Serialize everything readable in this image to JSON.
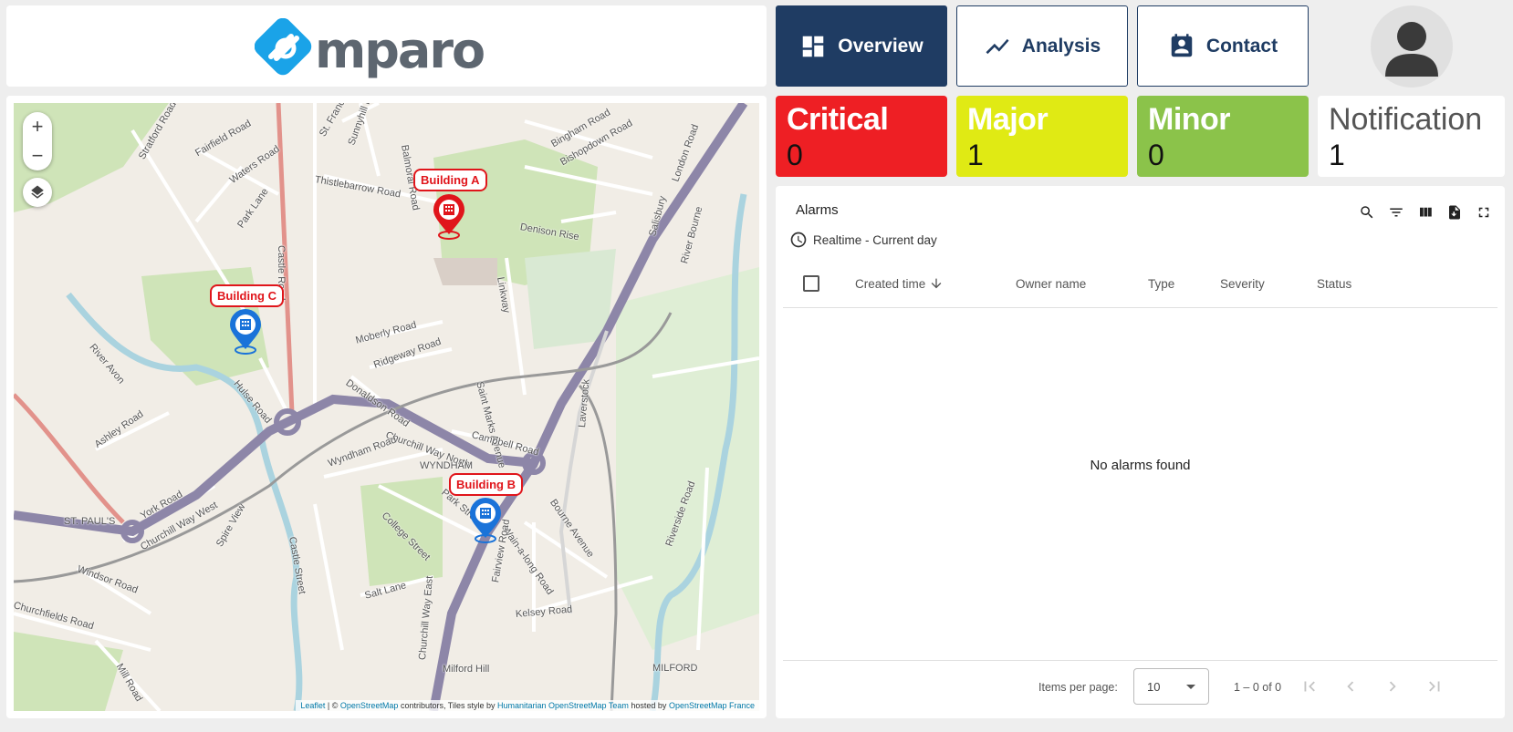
{
  "logo": {
    "text": "mparo",
    "brand_color": "#1aa3e8",
    "text_color": "#5d6670"
  },
  "nav": {
    "overview": "Overview",
    "analysis": "Analysis",
    "contact": "Contact",
    "active": "overview",
    "color": "#1f3c63"
  },
  "severity": {
    "critical": {
      "label": "Critical",
      "count": "0",
      "color": "#ee1f24"
    },
    "major": {
      "label": "Major",
      "count": "1",
      "color": "#e0ea14"
    },
    "minor": {
      "label": "Minor",
      "count": "0",
      "color": "#8bc34a"
    },
    "notification": {
      "label": "Notification",
      "count": "1",
      "color": "#ffffff"
    }
  },
  "map": {
    "zoom_in": "+",
    "zoom_out": "−",
    "markers": [
      {
        "label": "Building A",
        "color": "#e0151b"
      },
      {
        "label": "Building B",
        "color": "#1a73d9"
      },
      {
        "label": "Building C",
        "color": "#1a73d9"
      }
    ],
    "attribution": {
      "leaflet": "Leaflet",
      "sep": " | © ",
      "osm": "OpenStreetMap",
      "contrib": " contributors, Tiles style by ",
      "hot": "Humanitarian OpenStreetMap Team",
      "hosted": " hosted by ",
      "osmfr": "OpenStreetMap France"
    },
    "street_labels": [
      "Stratford Road",
      "Fairfield Road",
      "Waters Road",
      "Park Lane",
      "Castle Road",
      "St. Francis",
      "Sunnyhill Road",
      "Balmoral Road",
      "Thistlebarrow Road",
      "Bingham Road",
      "Bishopdown Road",
      "Denison Rise",
      "London Road",
      "Salisbury",
      "River Bourne",
      "Linkway",
      "Moberly Road",
      "Ridgeway Road",
      "Donaldson Road",
      "Hulse Road",
      "River Avon",
      "Saint Marks Avenue",
      "Ashley Road",
      "Churchill Way North",
      "Campbell Road",
      "Wyndham Road",
      "WYNDHAM",
      "Castle Street",
      "College Street",
      "Park Street",
      "Wain-a-long Road",
      "Bourne Avenue",
      "Laverstock",
      "Fairview Road",
      "Riverside Road",
      "York Road",
      "ST. PAUL'S",
      "Churchill Way West",
      "Spire View",
      "Windsor Road",
      "Salt Lane",
      "Kelsey Road",
      "Churchill Way East",
      "Churchfields Road",
      "Mill Road",
      "Milford Hill",
      "MILFORD"
    ]
  },
  "alarms": {
    "title": "Alarms",
    "timewindow": "Realtime - Current day",
    "columns": [
      "Created time",
      "Owner name",
      "Type",
      "Severity",
      "Status"
    ],
    "empty": "No alarms found",
    "items_per_page_label": "Items per page:",
    "items_per_page": "10",
    "range": "1 – 0 of 0"
  }
}
